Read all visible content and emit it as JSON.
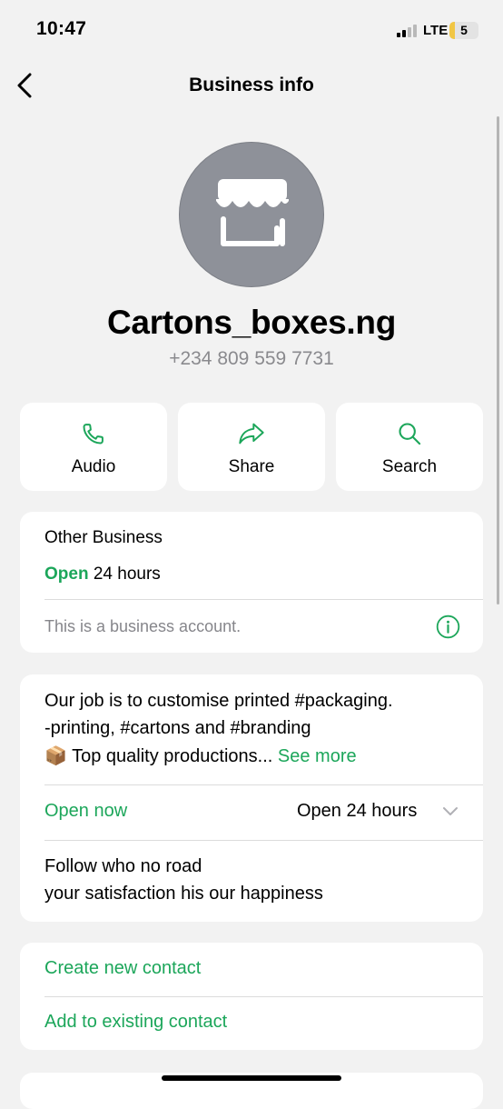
{
  "status_bar": {
    "time": "10:47",
    "network": "LTE",
    "battery": "5"
  },
  "nav": {
    "title": "Business info",
    "back_icon": "chevron-left-icon"
  },
  "profile": {
    "name": "Cartons_boxes.ng",
    "phone": "+234 809 559 7731",
    "avatar_icon": "storefront-icon",
    "avatar_color": "#8e9199"
  },
  "actions": [
    {
      "label": "Audio",
      "icon": "phone-icon"
    },
    {
      "label": "Share",
      "icon": "share-arrow-icon"
    },
    {
      "label": "Search",
      "icon": "search-icon"
    }
  ],
  "category_card": {
    "category": "Other Business",
    "open_label": "Open",
    "hours": " 24 hours",
    "note": "This is a business account.",
    "info_icon": "info-icon"
  },
  "about_card": {
    "line1": "Our job is to customise printed #packaging.",
    "line2": "-printing, #cartons and #branding",
    "line3_emoji": "📦",
    "line3": " Top quality productions...",
    "see_more": "See more",
    "status": "Open now",
    "hours": "Open 24 hours",
    "tagline1": "Follow who no road",
    "tagline2": "your satisfaction his our happiness"
  },
  "contact_card": {
    "create": "Create new contact",
    "add": "Add to existing contact"
  },
  "colors": {
    "accent": "#1ca65a",
    "background": "#f2f2f2",
    "card": "#ffffff",
    "secondary_text": "#86868b"
  }
}
